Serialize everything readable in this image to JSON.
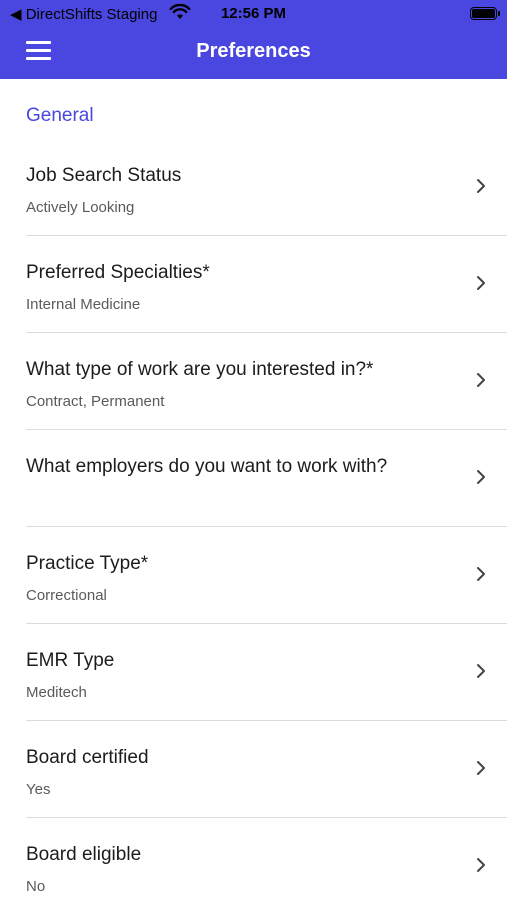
{
  "status_bar": {
    "back_label": "◀ DirectShifts Staging",
    "time": "12:56 PM"
  },
  "header": {
    "title": "Preferences",
    "background_color": "#4a47e0"
  },
  "section": {
    "title": "General",
    "accent_color": "#4a47e0"
  },
  "rows": [
    {
      "label": "Job Search Status",
      "value": "Actively Looking"
    },
    {
      "label": "Preferred Specialties*",
      "value": "Internal Medicine"
    },
    {
      "label": "What type of work are you interested in?*",
      "value": "Contract, Permanent"
    },
    {
      "label": "What employers do you want to work with?",
      "value": ""
    },
    {
      "label": "Practice Type*",
      "value": "Correctional"
    },
    {
      "label": "EMR Type",
      "value": "Meditech"
    },
    {
      "label": "Board certified",
      "value": "Yes"
    },
    {
      "label": "Board eligible",
      "value": "No"
    }
  ],
  "icons": {
    "menu": "hamburger-icon",
    "row_chevron": "chevron-right-icon",
    "wifi": "wifi-icon",
    "battery": "battery-icon"
  }
}
